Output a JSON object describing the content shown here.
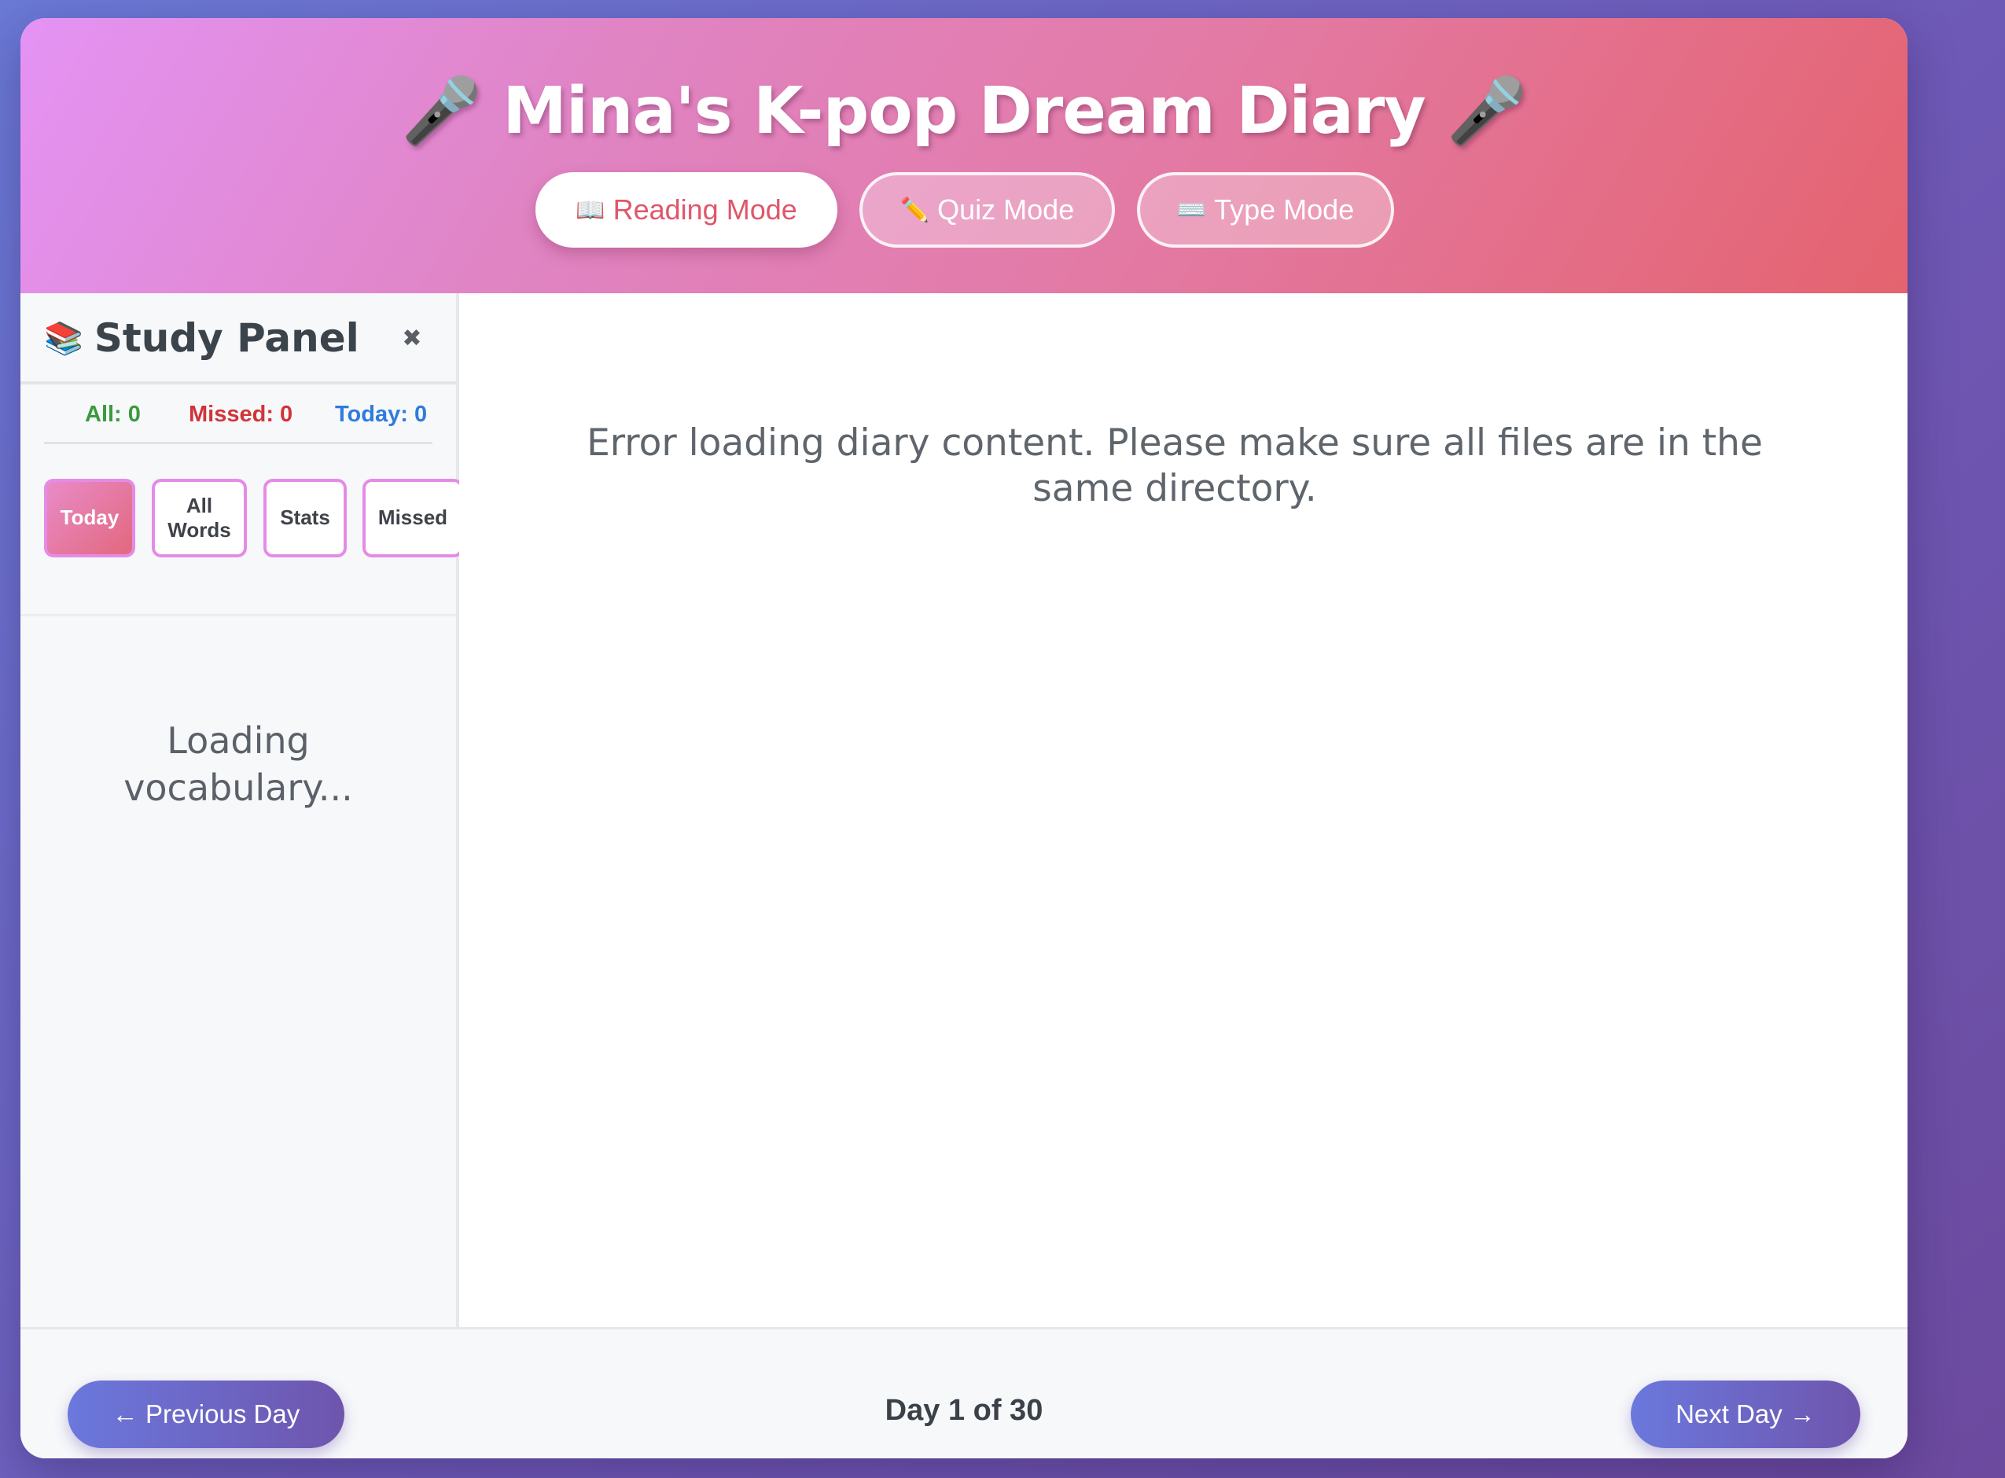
{
  "header": {
    "title_icon": "🎤",
    "title": "Mina's K-pop Dream Diary",
    "modes": [
      {
        "icon": "📖",
        "label": "Reading Mode",
        "active": true
      },
      {
        "icon": "✏️",
        "label": "Quiz Mode",
        "active": false
      },
      {
        "icon": "⌨️",
        "label": "Type Mode",
        "active": false
      }
    ]
  },
  "sidebar": {
    "title_icon": "📚",
    "title": "Study Panel",
    "close_symbol": "✖",
    "counts": {
      "all": "All: 0",
      "missed": "Missed: 0",
      "today": "Today: 0"
    },
    "filters": [
      {
        "label": "Today",
        "active": true
      },
      {
        "label": "All Words",
        "active": false
      },
      {
        "label": "Stats",
        "active": false
      },
      {
        "label": "Missed",
        "active": false
      }
    ],
    "loading_text": "Loading vocabulary..."
  },
  "content": {
    "error_message": "Error loading diary content. Please make sure all files are in the same directory."
  },
  "footer": {
    "prev_label": "← Previous Day",
    "next_label": "Next Day →",
    "day_indicator": "Day 1 of 30"
  },
  "colors": {
    "accent_pink": "#e0566a",
    "nav_purple": "#6b78dd",
    "all_green": "#3a9a3e",
    "missed_red": "#d13438",
    "today_blue": "#2f7bdd"
  }
}
